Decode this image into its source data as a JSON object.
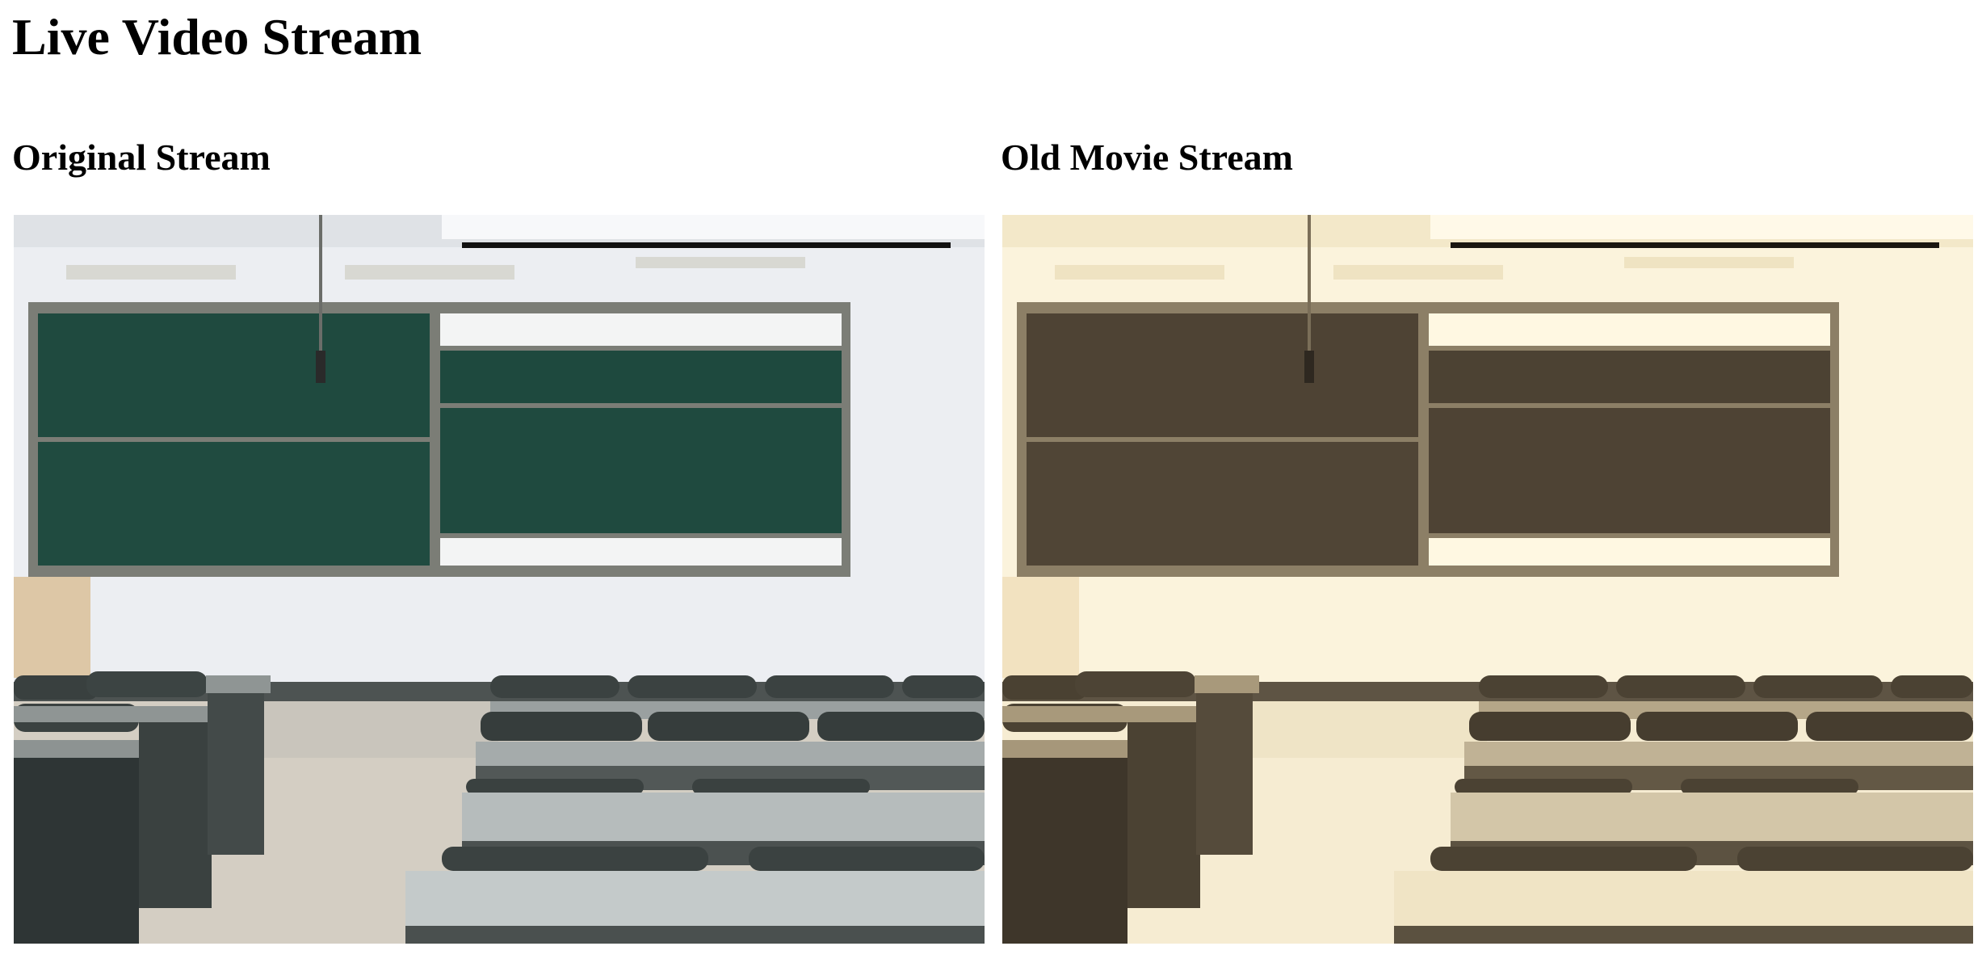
{
  "page": {
    "title": "Live Video Stream"
  },
  "streams": [
    {
      "heading": "Original Stream",
      "filter": "none"
    },
    {
      "heading": "Old Movie Stream",
      "filter": "sepia"
    }
  ],
  "colors": {
    "chalkboard_original": "#1f4a3f",
    "chalkboard_sepia": "#4e4334",
    "wall_original": "#eef0f3",
    "wall_sepia": "#fbf4dc"
  }
}
